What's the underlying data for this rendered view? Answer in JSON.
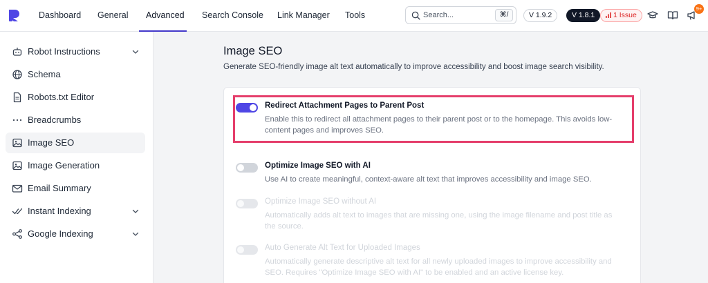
{
  "nav": {
    "tabs": [
      {
        "label": "Dashboard"
      },
      {
        "label": "General"
      },
      {
        "label": "Advanced"
      },
      {
        "label": "Search Console"
      },
      {
        "label": "Link Manager"
      },
      {
        "label": "Tools"
      }
    ],
    "active_tab": "Advanced"
  },
  "search": {
    "placeholder": "Search...",
    "shortcut": "⌘/"
  },
  "versions": {
    "plugin_free": "V 1.9.2",
    "plugin_pro": "V 1.8.1"
  },
  "issues": {
    "label": "1 Issue"
  },
  "notifications": {
    "count": "9+"
  },
  "colors": {
    "accent": "#4f46e5",
    "highlight": "#e53e6b",
    "issue": "#dc2626",
    "notification": "#f97316"
  },
  "sidebar": {
    "items": [
      {
        "label": "Robot Instructions",
        "icon": "robot-icon",
        "expandable": true
      },
      {
        "label": "Schema",
        "icon": "globe-icon"
      },
      {
        "label": "Robots.txt Editor",
        "icon": "file-icon"
      },
      {
        "label": "Breadcrumbs",
        "icon": "dots-icon"
      },
      {
        "label": "Image SEO",
        "icon": "image-icon",
        "active": true
      },
      {
        "label": "Image Generation",
        "icon": "image-icon"
      },
      {
        "label": "Email Summary",
        "icon": "mail-icon"
      },
      {
        "label": "Instant Indexing",
        "icon": "check-icon",
        "expandable": true
      },
      {
        "label": "Google Indexing",
        "icon": "branch-icon",
        "expandable": true
      }
    ]
  },
  "main": {
    "title": "Image SEO",
    "description": "Generate SEO-friendly image alt text automatically to improve accessibility and boost image search visibility.",
    "settings": [
      {
        "title": "Redirect Attachment Pages to Parent Post",
        "description": "Enable this to redirect all attachment pages to their parent post or to the homepage. This avoids low-content pages and improves SEO.",
        "state": "on"
      },
      {
        "title": "Optimize Image SEO with AI",
        "description": "Use AI to create meaningful, context-aware alt text that improves accessibility and image SEO.",
        "state": "off"
      },
      {
        "title": "Optimize Image SEO without AI",
        "description": "Automatically adds alt text to images that are missing one, using the image filename and post title as the source.",
        "state": "disabled"
      },
      {
        "title": "Auto Generate Alt Text for Uploaded Images",
        "description": "Automatically generate descriptive alt text for all newly uploaded images to improve accessibility and SEO. Requires \"Optimize Image SEO with AI\" to be enabled and an active license key.",
        "state": "disabled"
      }
    ]
  }
}
